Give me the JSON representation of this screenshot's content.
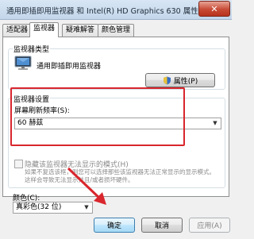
{
  "window": {
    "title": "通用即插即用监视器 和 Intel(R) HD Graphics 630 属性",
    "close_glyph": "✕"
  },
  "tabs": [
    {
      "label": "适配器",
      "active": false
    },
    {
      "label": "监视器",
      "active": true
    },
    {
      "label": "疑难解答",
      "active": false
    },
    {
      "label": "颜色管理",
      "active": false
    }
  ],
  "monitor_type": {
    "label": "监视器类型",
    "name": "通用即插即用监视器",
    "properties_button": "属性(P)"
  },
  "monitor_settings": {
    "label": "监视器设置",
    "refresh_label": "屏幕刷新频率(S):",
    "refresh_value": "60 赫兹",
    "hide_modes_label": "隐藏该监视器无法显示的模式(H)",
    "hide_modes_checked": false,
    "warning_text": "如果不复选该框，则您可以选择那些该监视器无法正常显示的显示模式。这样会导致无法显示并且/或者损坏硬件。"
  },
  "colors": {
    "label": "颜色(C):",
    "value": "真彩色(32 位)"
  },
  "footer": {
    "ok": "确定",
    "cancel": "取消",
    "apply": "应用(A)"
  },
  "accent": {
    "highlight_red": "#d9262d"
  }
}
